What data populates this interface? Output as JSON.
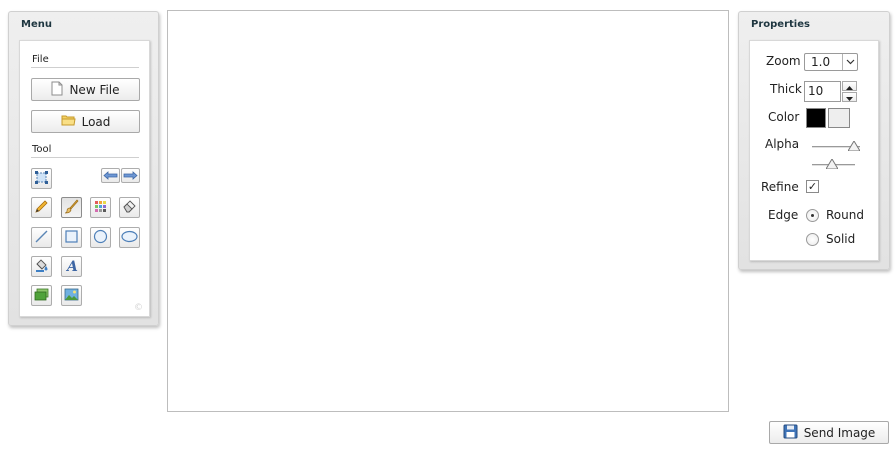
{
  "menu": {
    "title": "Menu",
    "file_section": "File",
    "new_file_label": "New File",
    "load_label": "Load",
    "tool_section": "Tool",
    "tools": [
      "select-icon",
      "undo-icon",
      "redo-icon",
      "pencil-icon",
      "brush-icon",
      "palette-icon",
      "eraser-icon",
      "line-icon",
      "rectangle-icon",
      "circle-icon",
      "ellipse-icon",
      "fill-bucket-icon",
      "text-icon",
      "layer-icon",
      "image-icon"
    ],
    "active_tool": "brush-icon"
  },
  "properties": {
    "title": "Properties",
    "zoom_label": "Zoom",
    "zoom_value": "1.0",
    "thick_label": "Thick",
    "thick_value": "10",
    "color_label": "Color",
    "primary_color": "#000000",
    "secondary_color": "#eeeeee",
    "alpha_label": "Alpha",
    "alpha_value": 1.0,
    "refine_label": "Refine",
    "refine_checked": true,
    "edge_label": "Edge",
    "edge_options": [
      "Round",
      "Solid"
    ],
    "edge_selected": "Round"
  },
  "actions": {
    "send_image_label": "Send Image"
  }
}
